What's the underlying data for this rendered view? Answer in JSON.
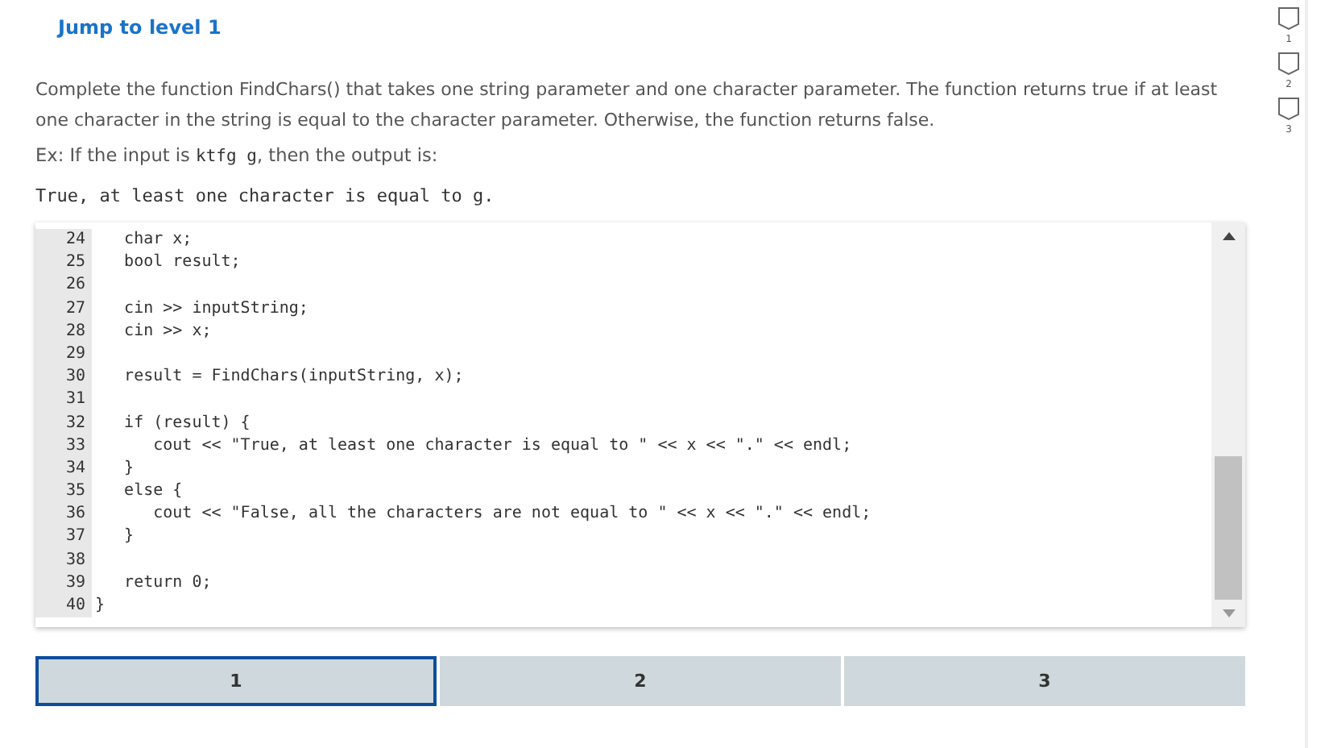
{
  "jump_link": "Jump to level 1",
  "instructions": "Complete the function FindChars() that takes one string parameter and one character parameter. The function returns true if at least one character in the string is equal to the character parameter. Otherwise, the function returns false.",
  "example": {
    "prefix": "Ex: If the input is ",
    "input": "ktfg g",
    "suffix": ", then the output is:"
  },
  "expected_output": "True, at least one character is equal to g.",
  "code_lines": [
    {
      "number": "24",
      "code": "   char x;"
    },
    {
      "number": "25",
      "code": "   bool result;"
    },
    {
      "number": "26"
    },
    {
      "number": "27",
      "code": "   cin >> inputString;"
    },
    {
      "number": "28",
      "code": "   cin >> x;"
    },
    {
      "number": "29"
    },
    {
      "number": "30",
      "code": "   result = FindChars(inputString, x);"
    },
    {
      "number": "31"
    },
    {
      "number": "32",
      "code": "   if (result) {"
    },
    {
      "number": "33",
      "code": "      cout << \"True, at least one character is equal to \" << x << \".\" << endl;"
    },
    {
      "number": "34",
      "code": "   }"
    },
    {
      "number": "35",
      "code": "   else {"
    },
    {
      "number": "36",
      "code": "      cout << \"False, all the characters are not equal to \" << x << \".\" << endl;"
    },
    {
      "number": "37",
      "code": "   }"
    },
    {
      "number": "38"
    },
    {
      "number": "39",
      "code": "   return 0;"
    },
    {
      "number": "40",
      "code": "}"
    }
  ],
  "levels": [
    {
      "label": "1",
      "selected": true
    },
    {
      "label": "2",
      "selected": false
    },
    {
      "label": "3",
      "selected": false
    }
  ],
  "level_markers": [
    "1",
    "2",
    "3"
  ]
}
